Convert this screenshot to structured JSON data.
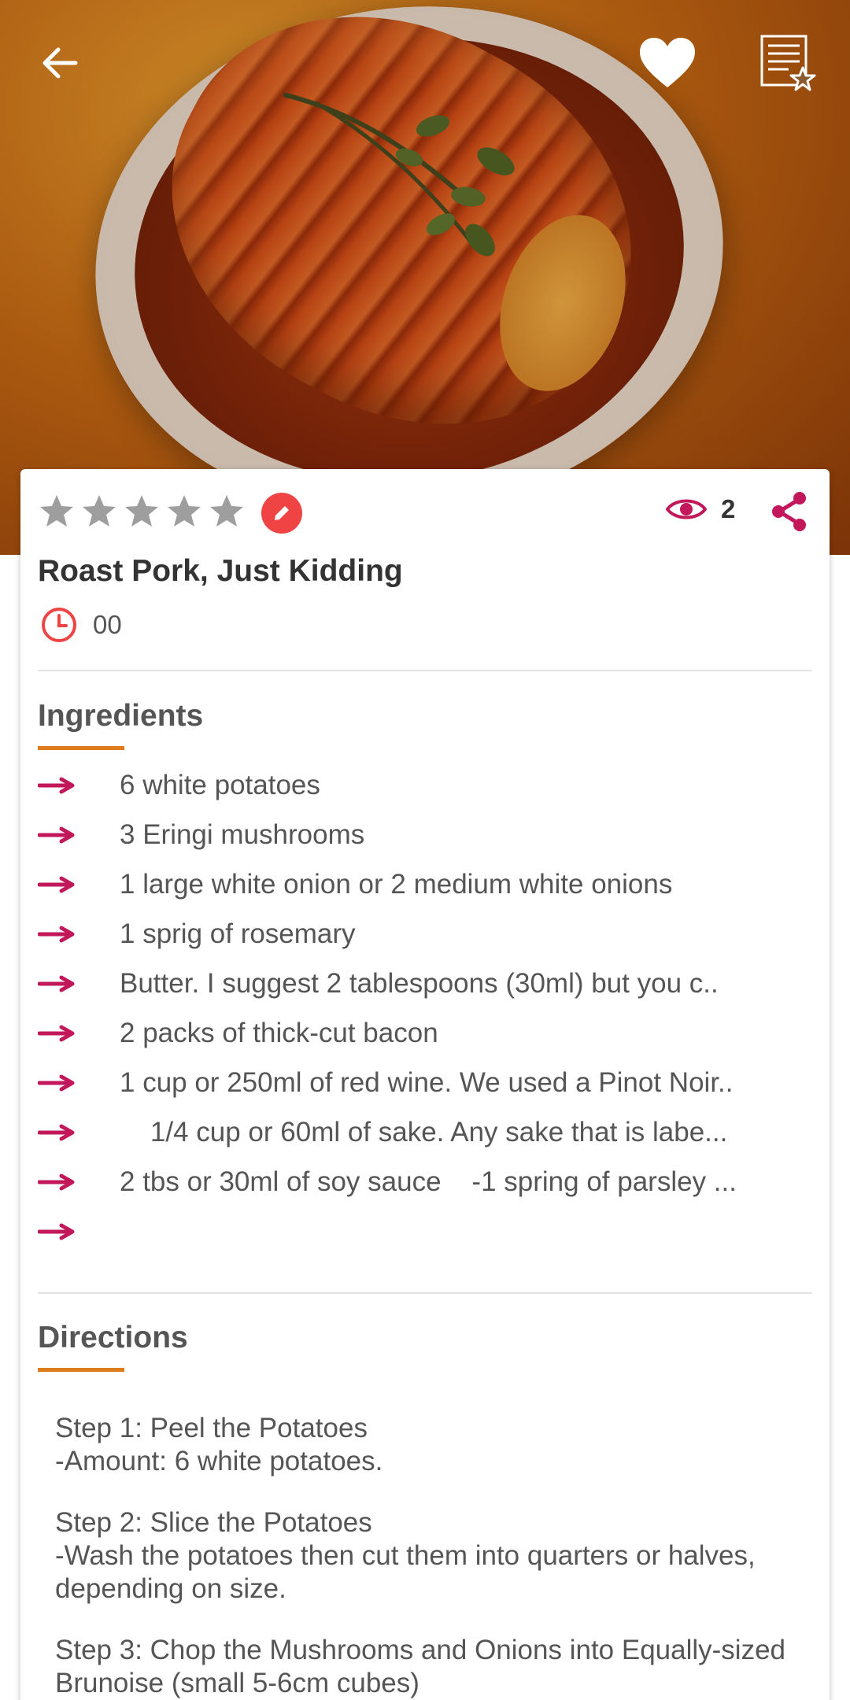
{
  "header": {
    "back_icon": "arrow-left-icon",
    "favorite_icon": "heart-icon",
    "shopping_list_icon": "list-star-icon"
  },
  "recipe": {
    "rating": 0,
    "rating_max": 5,
    "views": "2",
    "title": "Roast Pork, Just Kidding",
    "time": "00"
  },
  "ingredients": {
    "heading": "Ingredients",
    "items": [
      "6 white potatoes",
      "3 Eringi mushrooms",
      "1 large white onion or 2 medium white onions",
      "1 sprig of rosemary",
      "Butter. I suggest 2 tablespoons (30ml) but you c..",
      "2 packs of thick-cut bacon",
      "1 cup or 250ml of red wine. We used a Pinot Noir..",
      "    1/4 cup or 60ml of sake. Any sake that is labe...",
      "2 tbs or 30ml of soy sauce    -1 spring of parsley ...",
      ""
    ]
  },
  "directions": {
    "heading": "Directions",
    "steps": [
      "Step 1: Peel the Potatoes\n-Amount: 6 white potatoes.",
      "Step 2: Slice the Potatoes\n-Wash the potatoes then cut them into quarters or halves, depending on size.",
      "Step 3: Chop the Mushrooms and Onions into Equally-sized Brunoise (small 5-6cm cubes)"
    ]
  },
  "colors": {
    "accent": "#c2185b",
    "edit_button": "#f04444",
    "section_underline": "#e07b1c",
    "star_empty": "#9e9e9e"
  }
}
